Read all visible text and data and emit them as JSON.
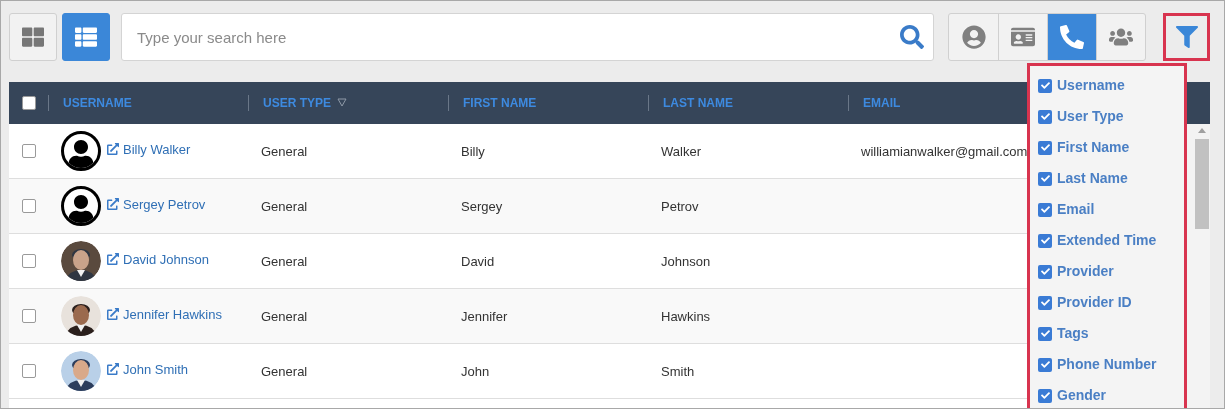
{
  "view_toggle": [
    {
      "kind": "grid",
      "selected": false
    },
    {
      "kind": "list",
      "selected": true
    }
  ],
  "search": {
    "placeholder": "Type your search here"
  },
  "contact_filters": [
    {
      "kind": "person",
      "selected": false
    },
    {
      "kind": "card",
      "selected": false
    },
    {
      "kind": "phone",
      "selected": true
    },
    {
      "kind": "group",
      "selected": false
    }
  ],
  "column_menu": {
    "expanded": true,
    "items": [
      {
        "label": "Username",
        "checked": true
      },
      {
        "label": "User Type",
        "checked": true
      },
      {
        "label": "First Name",
        "checked": true
      },
      {
        "label": "Last Name",
        "checked": true
      },
      {
        "label": "Email",
        "checked": true
      },
      {
        "label": "Extended Time",
        "checked": true
      },
      {
        "label": "Provider",
        "checked": true
      },
      {
        "label": "Provider ID",
        "checked": true
      },
      {
        "label": "Tags",
        "checked": true
      },
      {
        "label": "Phone Number",
        "checked": true
      },
      {
        "label": "Gender",
        "checked": true
      }
    ]
  },
  "table": {
    "select_all": {
      "checked": false
    },
    "columns": [
      {
        "label": "USERNAME",
        "kind": "plain"
      },
      {
        "label": "USER TYPE",
        "kind": "filterable"
      },
      {
        "label": "FIRST NAME",
        "kind": "plain"
      },
      {
        "label": "LAST NAME",
        "kind": "plain"
      },
      {
        "label": "EMAIL",
        "kind": "plain"
      }
    ],
    "rows": [
      {
        "checked": false,
        "kind": "default",
        "username": "Billy Walker",
        "user_type": "General",
        "first_name": "Billy",
        "last_name": "Walker",
        "email": "williamianwalker@gmail.com"
      },
      {
        "checked": false,
        "kind": "default",
        "username": "Sergey Petrov",
        "user_type": "General",
        "first_name": "Sergey",
        "last_name": "Petrov"
      },
      {
        "checked": false,
        "username": "David Johnson",
        "user_type": "General",
        "first_name": "David",
        "last_name": "Johnson"
      },
      {
        "checked": false,
        "username": "Jennifer Hawkins",
        "user_type": "General",
        "first_name": "Jennifer",
        "last_name": "Hawkins"
      },
      {
        "checked": false,
        "username": "John Smith",
        "user_type": "General",
        "first_name": "John",
        "last_name": "Smith"
      }
    ]
  }
}
